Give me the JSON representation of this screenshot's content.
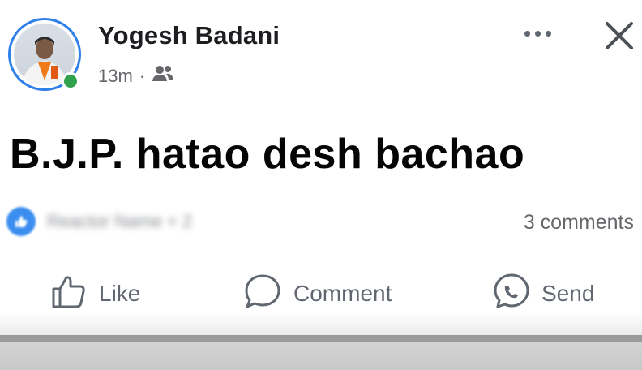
{
  "post": {
    "author_name": "Yogesh Badani",
    "timestamp": "13m",
    "separator": "·",
    "audience_icon": "friends-icon",
    "text": "B.J.P. hatao desh bachao",
    "reactors_text": "Reactor Name + 2",
    "comments_text": "3 comments"
  },
  "actions": {
    "like_label": "Like",
    "comment_label": "Comment",
    "send_label": "Send"
  },
  "icons": {
    "more": "more-options-icon",
    "close": "close-icon",
    "like": "thumbs-up-icon",
    "comment": "comment-bubble-icon",
    "send": "messenger-icon"
  },
  "colors": {
    "online": "#31a24c",
    "avatar_ring": "#2f80e8",
    "reaction_like": "#3b8ef0",
    "secondary_text": "#65676b"
  }
}
